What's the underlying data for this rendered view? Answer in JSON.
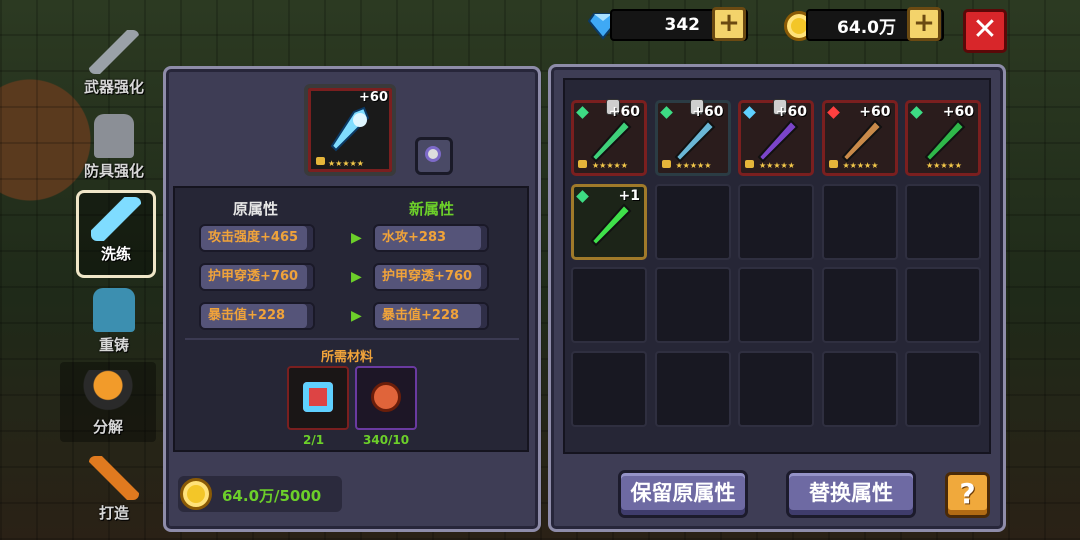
{
  "currencies": {
    "gems": "342",
    "gold": "64.0万"
  },
  "colors": {
    "accent_orange": "#f0a33a",
    "new_attr_green": "#6ccf2a",
    "panel": "#3e3d55",
    "close_red": "#d8262a"
  },
  "sidebar": {
    "items": [
      {
        "label": "武器强化",
        "icon": "sword-icon"
      },
      {
        "label": "防具强化",
        "icon": "armor-icon"
      },
      {
        "label": "洗练",
        "icon": "crystal-sword-icon"
      },
      {
        "label": "重铸",
        "icon": "reforge-armor-icon"
      },
      {
        "label": "分解",
        "icon": "cauldron-icon"
      },
      {
        "label": "打造",
        "icon": "forge-hammer-icon"
      }
    ],
    "active": "洗练"
  },
  "refine": {
    "selected_item_level": "+60",
    "old_header": "原属性",
    "new_header": "新属性",
    "old_attrs": [
      "攻击强度+465",
      "护甲穿透+760",
      "暴击值+228"
    ],
    "new_attrs": [
      "水攻+283",
      "护甲穿透+760",
      "暴击值+228"
    ],
    "materials_title": "所需材料",
    "materials": [
      {
        "icon": "ice-sword-material-icon",
        "count": "2/1"
      },
      {
        "icon": "refine-stone-icon",
        "count": "340/10"
      }
    ],
    "gold_cost": "64.0万/5000"
  },
  "inventory": {
    "items": [
      {
        "level": "+60",
        "icon": "green-blade-icon",
        "gem": "#3ddc84",
        "locked": true,
        "pinned": true,
        "frame": "#7a1f1f"
      },
      {
        "level": "+60",
        "icon": "ice-axe-icon",
        "gem": "#3ddc84",
        "locked": true,
        "pinned": true,
        "frame": "#2b3c44"
      },
      {
        "level": "+60",
        "icon": "purple-sword-icon",
        "gem": "#5fd0ff",
        "locked": true,
        "pinned": true,
        "frame": "#7a1f1f"
      },
      {
        "level": "+60",
        "icon": "torch-spear-icon",
        "gem": "#ff4040",
        "locked": true,
        "pinned": false,
        "frame": "#7a1f1f"
      },
      {
        "level": "+60",
        "icon": "emerald-staff-icon",
        "gem": "#3ddc84",
        "locked": false,
        "pinned": false,
        "frame": "#7a1f1f"
      },
      {
        "level": "+1",
        "icon": "green-blaster-icon",
        "gem": "#3ddc84",
        "locked": false,
        "pinned": false,
        "frame": "#a07a2a"
      }
    ]
  },
  "buttons": {
    "keep": "保留原属性",
    "replace": "替换属性",
    "help": "?"
  }
}
